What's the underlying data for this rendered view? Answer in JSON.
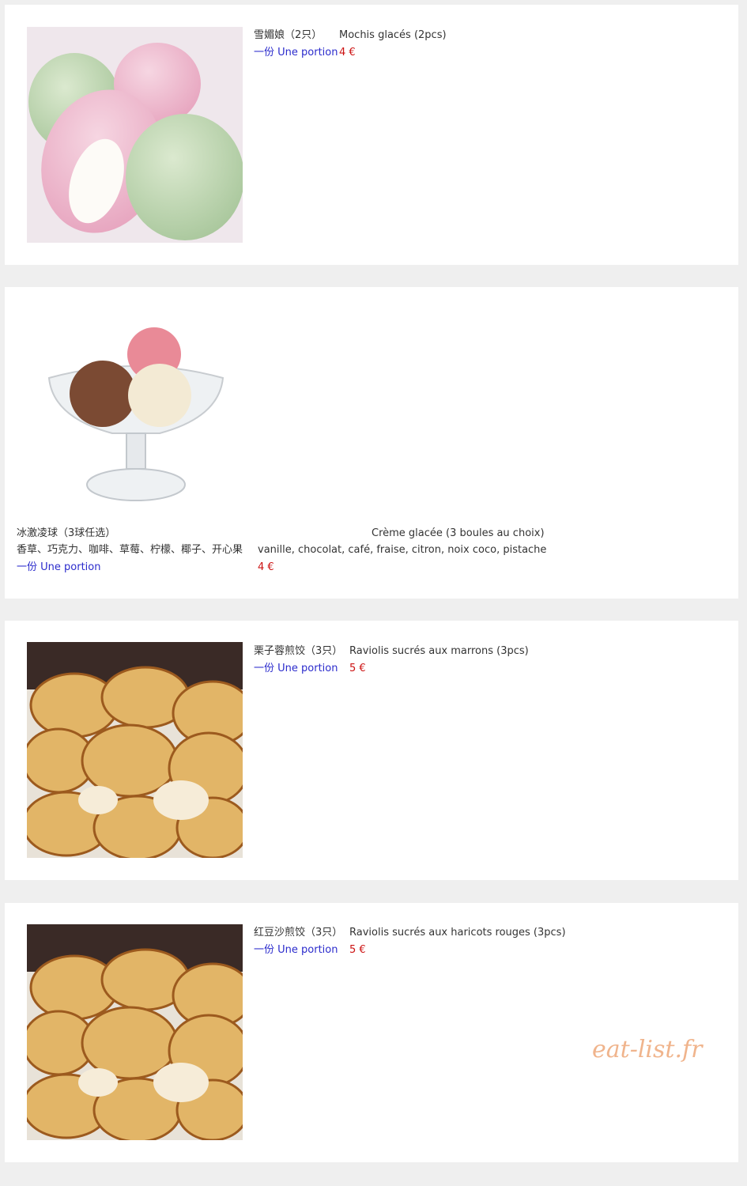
{
  "items": [
    {
      "name_zh": "雪媚娘（2只）",
      "name_fr": "Mochis glacés (2pcs)",
      "portion_label": "一份 Une portion",
      "price": "4 €",
      "image_icon": "mochi-photo"
    },
    {
      "name_zh": "冰激凌球（3球任选）",
      "name_fr": "Crème glacée (3 boules au choix)",
      "flavors_zh": "香草、巧克力、咖啡、草莓、柠檬、椰子、开心果",
      "flavors_fr": "vanille, chocolat, café, fraise, citron, noix coco, pistache",
      "portion_label": "一份 Une portion",
      "price": "4 €",
      "image_icon": "ice-cream-photo"
    },
    {
      "name_zh": "栗子蓉煎饺（3只）",
      "name_fr": "Raviolis sucrés aux marrons (3pcs)",
      "portion_label": "一份 Une portion",
      "price": "5 €",
      "image_icon": "fried-dumplings-photo"
    },
    {
      "name_zh": "红豆沙煎饺（3只）",
      "name_fr": "Raviolis sucrés aux haricots rouges (3pcs)",
      "portion_label": "一份 Une portion",
      "price": "5 €",
      "image_icon": "fried-dumplings-photo"
    }
  ],
  "watermark": "eat-list.fr",
  "colors": {
    "background": "#efefef",
    "card": "#ffffff",
    "portion": "#2b2bcc",
    "price": "#cc1111",
    "watermark": "#f0b48c"
  }
}
